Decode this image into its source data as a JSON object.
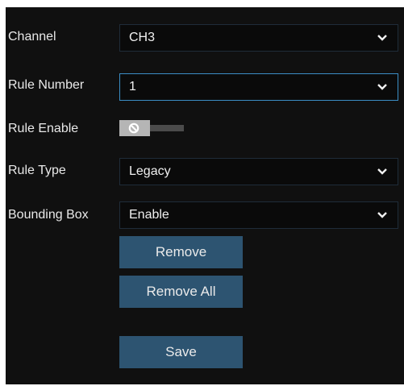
{
  "form": {
    "channel": {
      "label": "Channel",
      "value": "CH3"
    },
    "rule_number": {
      "label": "Rule Number",
      "value": "1"
    },
    "rule_enable": {
      "label": "Rule Enable",
      "state": "off"
    },
    "rule_type": {
      "label": "Rule Type",
      "value": "Legacy"
    },
    "bounding_box": {
      "label": "Bounding Box",
      "value": "Enable"
    }
  },
  "buttons": {
    "remove": "Remove",
    "remove_all": "Remove All",
    "save": "Save"
  },
  "colors": {
    "panel_bg": "#101010",
    "button_bg": "#2d5471",
    "active_border": "#3b8ec6",
    "text": "#e9e9e9"
  },
  "icons": {
    "dropdown": "chevron-down-icon",
    "toggle": "disabled-circle-icon"
  }
}
